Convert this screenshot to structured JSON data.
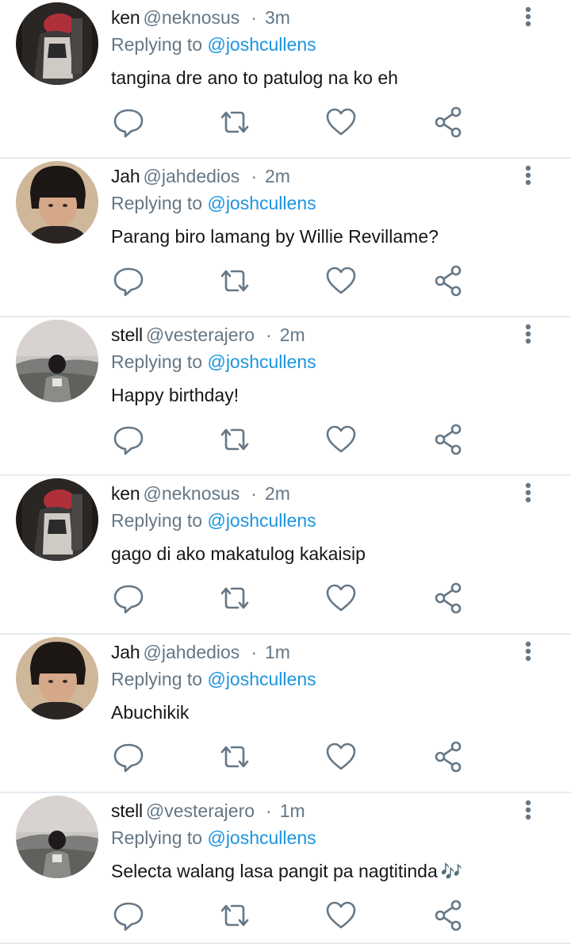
{
  "replying_to_label": "Replying to",
  "tweets": [
    {
      "name": "ken",
      "handle": "@neknosus",
      "separator": "·",
      "time": "3m",
      "mention": "@joshcullens",
      "text": "tangina dre ano to patulog na ko eh",
      "emoji": ""
    },
    {
      "name": "Jah",
      "handle": "@jahdedios",
      "separator": "·",
      "time": "2m",
      "mention": "@joshcullens",
      "text": "Parang biro lamang by Willie Revillame?",
      "emoji": ""
    },
    {
      "name": "stell",
      "handle": "@vesterajero",
      "separator": "·",
      "time": "2m",
      "mention": "@joshcullens",
      "text": "Happy birthday!",
      "emoji": ""
    },
    {
      "name": "ken",
      "handle": "@neknosus",
      "separator": "·",
      "time": "2m",
      "mention": "@joshcullens",
      "text": "gago di ako makatulog kakaisip",
      "emoji": ""
    },
    {
      "name": "Jah",
      "handle": "@jahdedios",
      "separator": "·",
      "time": "1m",
      "mention": "@joshcullens",
      "text": "Abuchikik",
      "emoji": ""
    },
    {
      "name": "stell",
      "handle": "@vesterajero",
      "separator": "·",
      "time": "1m",
      "mention": "@joshcullens",
      "text": "Selecta walang lasa pangit pa nagtitinda",
      "emoji": "🎶"
    }
  ],
  "icons": {
    "reply": "reply-icon",
    "retweet": "retweet-icon",
    "like": "heart-icon",
    "share": "share-icon",
    "more": "more-vertical-icon"
  },
  "colors": {
    "text": "#14171a",
    "secondary": "#657786",
    "mention": "#1b95e0",
    "icon": "#657786",
    "divider": "#e6ecf0",
    "emoji": "#55acee"
  }
}
